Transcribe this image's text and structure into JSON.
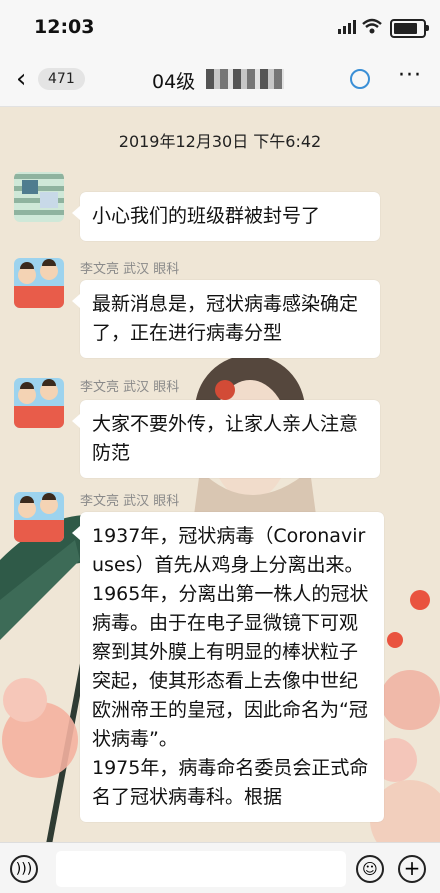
{
  "status": {
    "time": "12:03"
  },
  "nav": {
    "back_icon": "chevron-left",
    "unread_count": "471",
    "chat_title": "04级"
  },
  "chat": {
    "timestamp": "2019年12月30日 下午6:42",
    "messages": [
      {
        "sender": "",
        "text": "小心我们的班级群被封号了",
        "avatar": "pixelated"
      },
      {
        "sender": "李文亮 武汉 眼科",
        "text": "最新消息是，冠状病毒感染确定了，正在进行病毒分型",
        "avatar": "cartoon"
      },
      {
        "sender": "李文亮 武汉 眼科",
        "text": "大家不要外传，让家人亲人注意防范",
        "avatar": "cartoon"
      },
      {
        "sender": "李文亮 武汉 眼科",
        "text": "1937年，冠状病毒（Coronaviruses）首先从鸡身上分离出来。\n1965年，分离出第一株人的冠状病毒。由于在电子显微镜下可观察到其外膜上有明显的棒状粒子突起，使其形态看上去像中世纪欧洲帝王的皇冠，因此命名为“冠状病毒”。\n1975年，病毒命名委员会正式命名了冠状病毒科。根据",
        "avatar": "cartoon"
      }
    ]
  },
  "icons": [
    "signal-icon",
    "wifi-icon",
    "battery-icon",
    "back-chevron-icon",
    "status-ring-icon",
    "more-icon",
    "voice-icon",
    "emoji-icon",
    "plus-icon"
  ]
}
